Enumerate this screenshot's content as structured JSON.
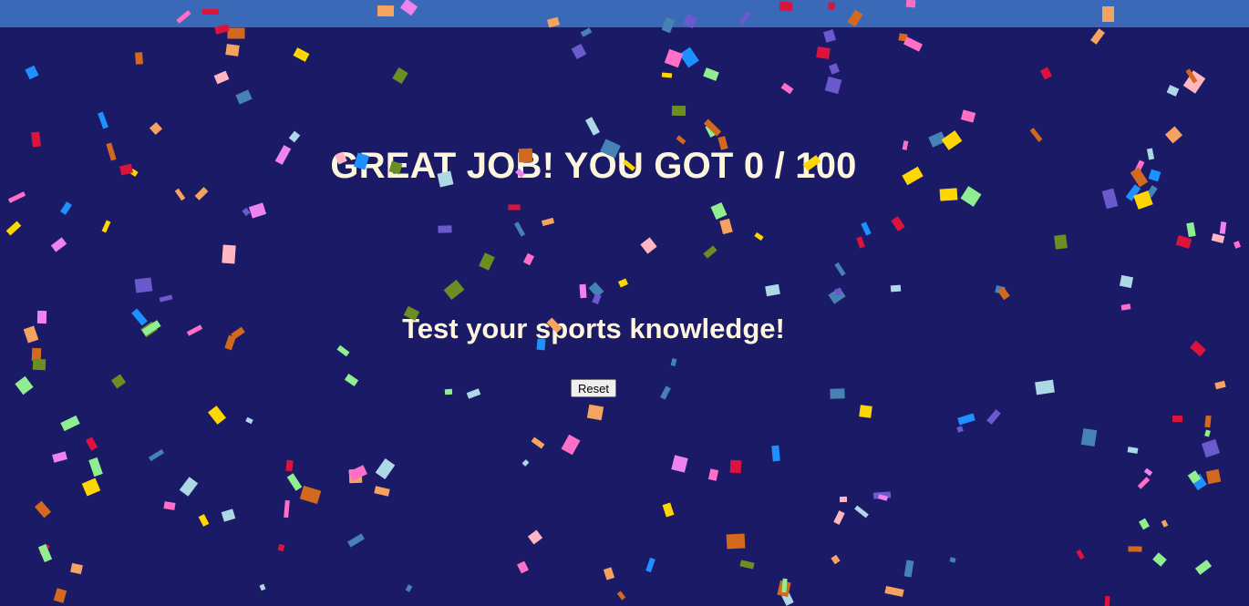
{
  "result": {
    "headline": "GREAT JOB! YOU GOT 0 / 100",
    "score": 0,
    "total": 100
  },
  "quiz": {
    "tagline": "Test your sports knowledge!",
    "reset_label": "Reset"
  },
  "theme": {
    "background": "#1a1a66",
    "topbar": "#3a69b8",
    "text": "#fdf6dc"
  },
  "confetti_colors": [
    "#ff6ec7",
    "#ffd700",
    "#1e90ff",
    "#dc143c",
    "#6a5acd",
    "#90ee90",
    "#f4a460",
    "#6b8e23",
    "#add8e6",
    "#ffb6c1",
    "#d2691e",
    "#4682b4",
    "#ee82ee"
  ]
}
